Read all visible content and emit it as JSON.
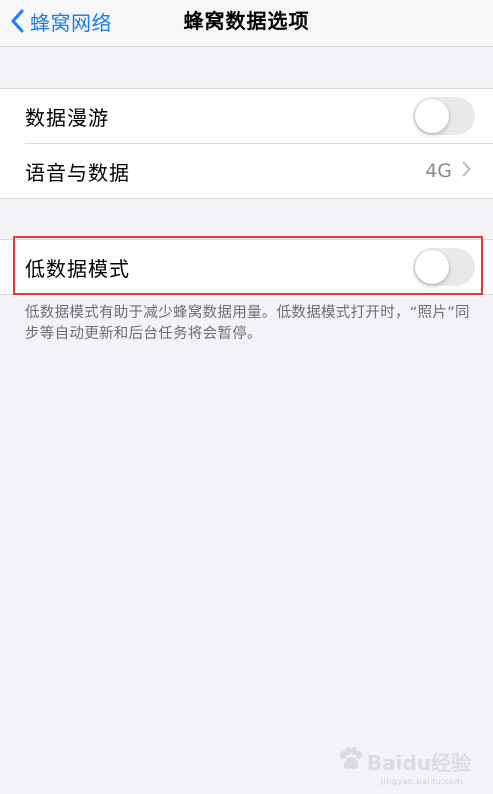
{
  "nav": {
    "back_label": "蜂窝网络",
    "title": "蜂窝数据选项"
  },
  "group1": {
    "roaming_label": "数据漫游",
    "roaming_enabled": false,
    "voice_data_label": "语音与数据",
    "voice_data_value": "4G"
  },
  "group2": {
    "low_data_label": "低数据模式",
    "low_data_enabled": false
  },
  "footnote": "低数据模式有助于减少蜂窝数据用量。低数据模式打开时，“照片”同步等自动更新和后台任务将会暂停。",
  "watermark": {
    "brand": "Baidu经验",
    "url": "jingyan.baidu.com"
  },
  "colors": {
    "accent": "#1f7cf2",
    "highlight": "#e53935",
    "toggle_off": "#e9e9eb"
  },
  "icons": {
    "back": "chevron-left-icon",
    "disclosure": "chevron-right-icon",
    "watermark": "paw-icon"
  }
}
